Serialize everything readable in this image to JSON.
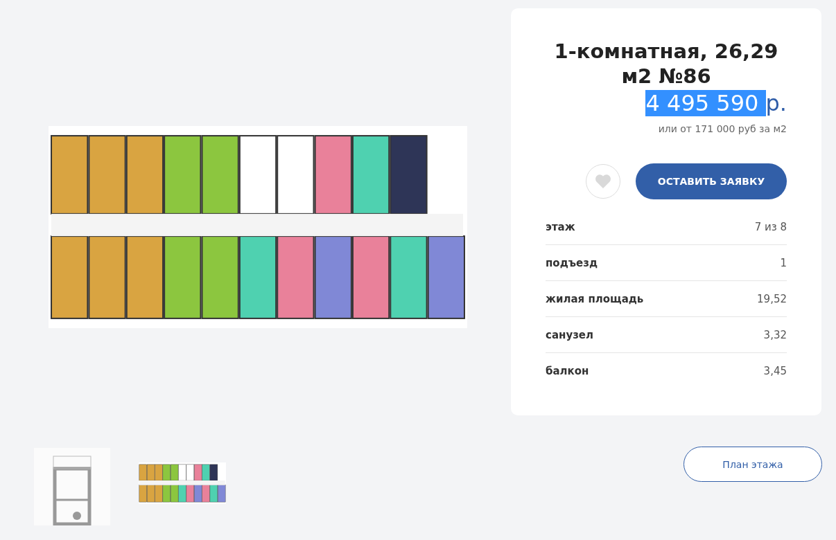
{
  "listing": {
    "title": "1-комнатная, 26,29 м2 №86",
    "price": {
      "amount": "4 495 590 ",
      "currency": "р.",
      "highlighted": true
    },
    "price_per_m2": "или от 171 000 руб за м2",
    "favorite": {
      "selected": false
    },
    "apply_button": "ОСТАВИТЬ ЗАЯВКУ",
    "details": [
      {
        "label": "этаж",
        "value": "7 из 8"
      },
      {
        "label": "подъезд",
        "value": "1"
      },
      {
        "label": "жилая площадь",
        "value": "19,52"
      },
      {
        "label": "санузел",
        "value": "3,32"
      },
      {
        "label": "балкон",
        "value": "3,45"
      }
    ]
  },
  "floor_plan_button": "План этажа"
}
